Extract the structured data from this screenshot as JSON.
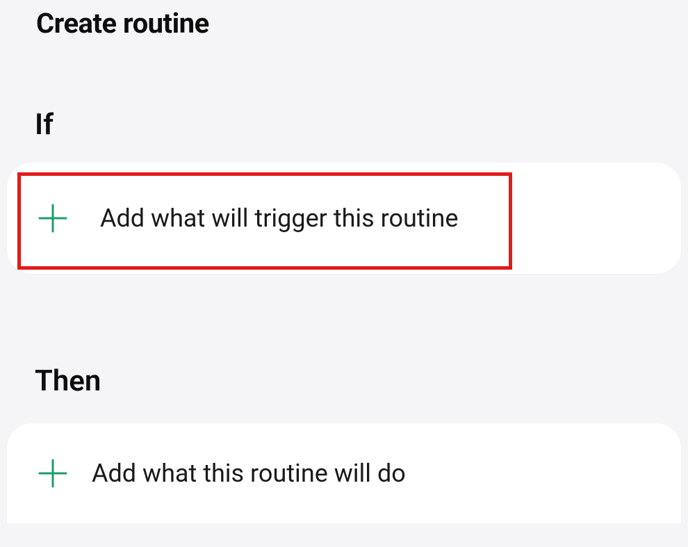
{
  "header": {
    "title": "Create routine"
  },
  "sections": {
    "if": {
      "label": "If",
      "card": {
        "add_label": "Add what will trigger this routine",
        "icon_color": "#1e9e6a"
      }
    },
    "then": {
      "label": "Then",
      "card": {
        "add_label": "Add what this routine will do",
        "icon_color": "#1e9e6a"
      }
    }
  },
  "highlight": {
    "visible": true
  }
}
